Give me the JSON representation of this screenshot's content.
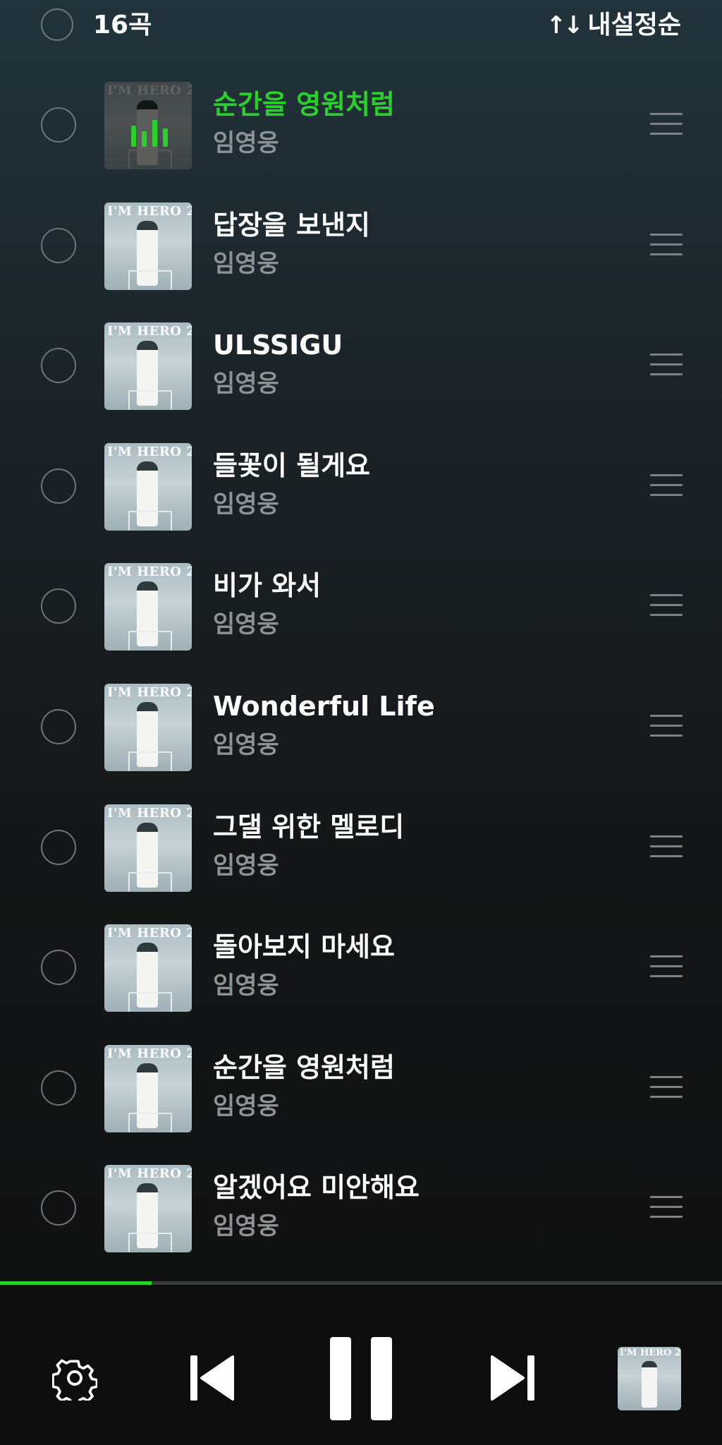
{
  "header": {
    "track_count": "16곡",
    "sort_icon": "↑↓",
    "sort_label": "내설정순"
  },
  "album_logo": "I'M HERO 2",
  "tracks": [
    {
      "title": "순간을 영원처럼",
      "artist": "임영웅",
      "playing": true
    },
    {
      "title": "답장을 보낸지",
      "artist": "임영웅",
      "playing": false
    },
    {
      "title": "ULSSIGU",
      "artist": "임영웅",
      "playing": false
    },
    {
      "title": "들꽃이 될게요",
      "artist": "임영웅",
      "playing": false
    },
    {
      "title": "비가 와서",
      "artist": "임영웅",
      "playing": false
    },
    {
      "title": "Wonderful Life",
      "artist": "임영웅",
      "playing": false
    },
    {
      "title": "그댈 위한 멜로디",
      "artist": "임영웅",
      "playing": false
    },
    {
      "title": "돌아보지 마세요",
      "artist": "임영웅",
      "playing": false
    },
    {
      "title": "순간을 영원처럼",
      "artist": "임영웅",
      "playing": false
    },
    {
      "title": "알겠어요 미안해요",
      "artist": "임영웅",
      "playing": false
    }
  ],
  "player": {
    "progress": 0.21,
    "icons": [
      "settings-icon",
      "previous-icon",
      "pause-icon",
      "next-icon",
      "album-thumbnail"
    ]
  },
  "colors": {
    "accent": "#2ad12a",
    "secondary_text": "#8d9295"
  }
}
